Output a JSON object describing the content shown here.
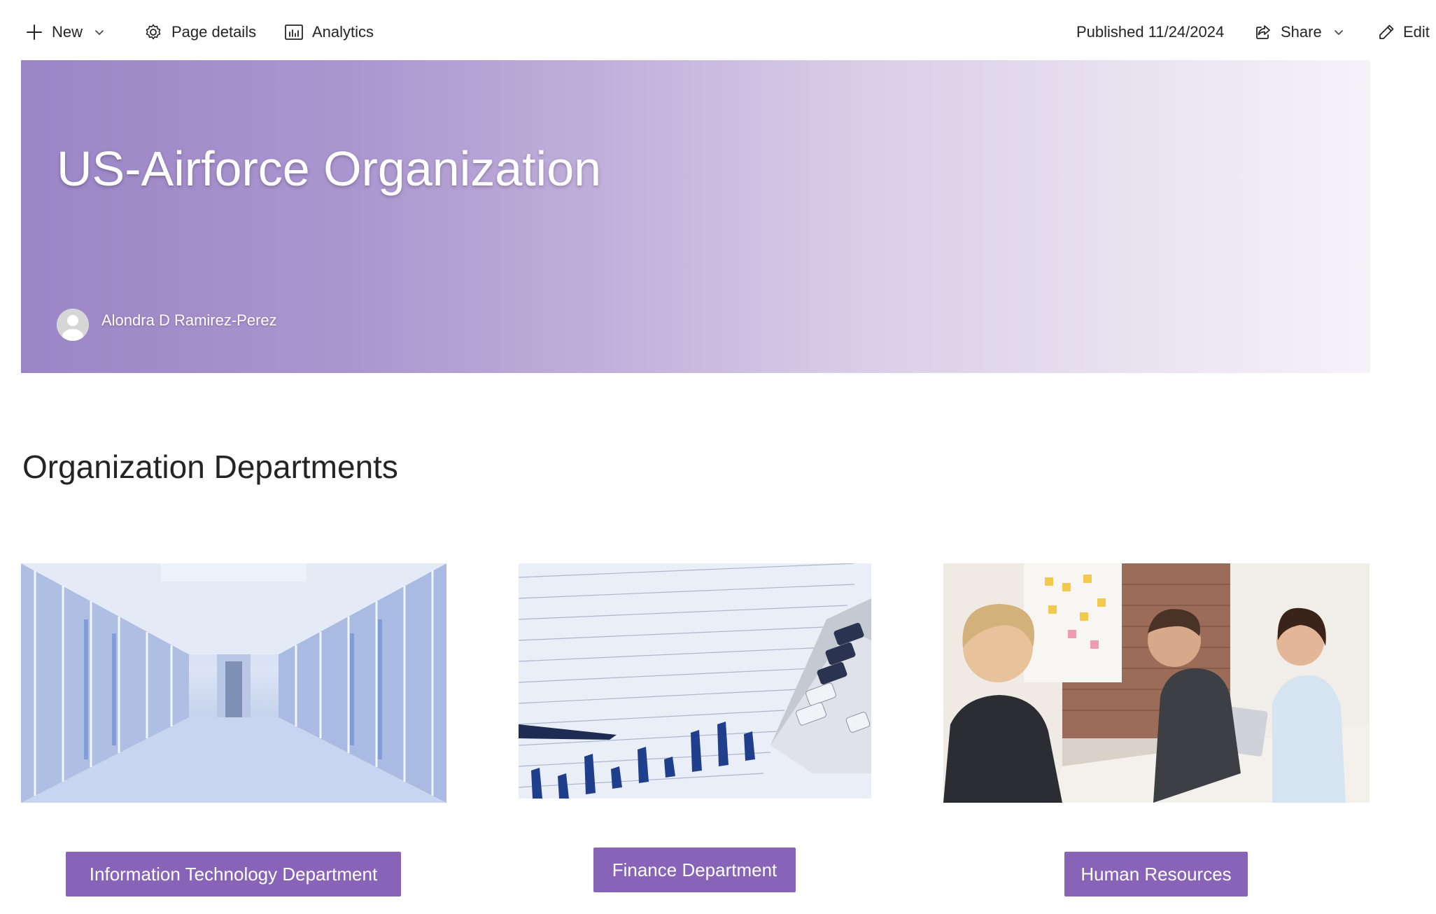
{
  "toolbar": {
    "new_label": "New",
    "page_details_label": "Page details",
    "analytics_label": "Analytics",
    "published_label": "Published 11/24/2024",
    "share_label": "Share",
    "edit_label": "Edit"
  },
  "hero": {
    "title": "US-Airforce Organization",
    "author": "Alondra D Ramirez-Perez"
  },
  "section": {
    "title": "Organization Departments"
  },
  "departments": [
    {
      "label": "Information Technology Department",
      "image": "server-room-image"
    },
    {
      "label": "Finance Department",
      "image": "finance-spreadsheet-image"
    },
    {
      "label": "Human Resources",
      "image": "hr-meeting-image"
    }
  ],
  "colors": {
    "accent": "#8764b8",
    "hero_start": "#9b85c6",
    "hero_end": "#f5f2f8"
  }
}
